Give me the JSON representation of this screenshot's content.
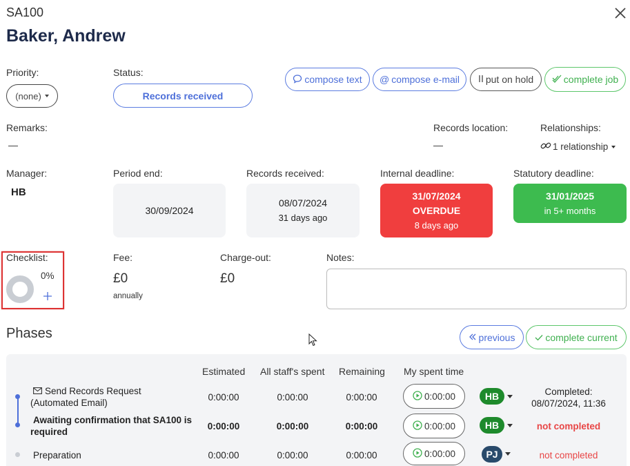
{
  "header": {
    "code": "SA100",
    "client_name": "Baker, Andrew"
  },
  "priority": {
    "label": "Priority:",
    "value": "(none)"
  },
  "status": {
    "label": "Status:",
    "value": "Records received"
  },
  "actions": {
    "compose_text": "compose text",
    "compose_email": "compose e-mail",
    "put_on_hold": "put on hold",
    "complete_job": "complete job"
  },
  "remarks": {
    "label": "Remarks:",
    "value": "—"
  },
  "records_location": {
    "label": "Records location:",
    "value": "—"
  },
  "relationships": {
    "label": "Relationships:",
    "value": "1 relationship"
  },
  "manager": {
    "label": "Manager:",
    "value": "HB"
  },
  "period_end": {
    "label": "Period end:",
    "value": "30/09/2024"
  },
  "records_received": {
    "label": "Records received:",
    "date": "08/07/2024",
    "ago": "31 days ago"
  },
  "internal_deadline": {
    "label": "Internal deadline:",
    "date": "31/07/2024",
    "state": "OVERDUE",
    "ago": "8 days ago"
  },
  "statutory_deadline": {
    "label": "Statutory deadline:",
    "date": "31/01/2025",
    "remaining": "in 5+ months"
  },
  "checklist": {
    "label": "Checklist:",
    "percent": "0%",
    "progress": 0
  },
  "fee": {
    "label": "Fee:",
    "value": "£0",
    "period": "annually"
  },
  "charge_out": {
    "label": "Charge-out:",
    "value": "£0"
  },
  "notes": {
    "label": "Notes:",
    "value": ""
  },
  "phases": {
    "title": "Phases",
    "previous": "previous",
    "complete_current": "complete current",
    "columns": [
      "Estimated",
      "All staff's spent",
      "Remaining",
      "My spent time"
    ],
    "rows": [
      {
        "name_line1": "Send Records Request",
        "name_line2": "(Automated Email)",
        "estimated": "0:00:00",
        "all_spent": "0:00:00",
        "remaining": "0:00:00",
        "my_time": "0:00:00",
        "assignee": "HB",
        "status_line1": "Completed:",
        "status_line2": "08/07/2024, 11:36"
      },
      {
        "name_line1": "Awaiting confirmation that SA100 is",
        "name_line2": "required",
        "estimated": "0:00:00",
        "all_spent": "0:00:00",
        "remaining": "0:00:00",
        "my_time": "0:00:00",
        "assignee": "HB",
        "status_line1": "not completed"
      },
      {
        "name_line1": "Preparation",
        "estimated": "0:00:00",
        "all_spent": "0:00:00",
        "remaining": "0:00:00",
        "my_time": "0:00:00",
        "assignee": "PJ",
        "status_line1": "not completed"
      }
    ]
  },
  "colors": {
    "accent": "#4d6fd9",
    "overdue": "#f03e3e",
    "ok": "#3dbb4f",
    "navy": "#1d2a4a"
  }
}
